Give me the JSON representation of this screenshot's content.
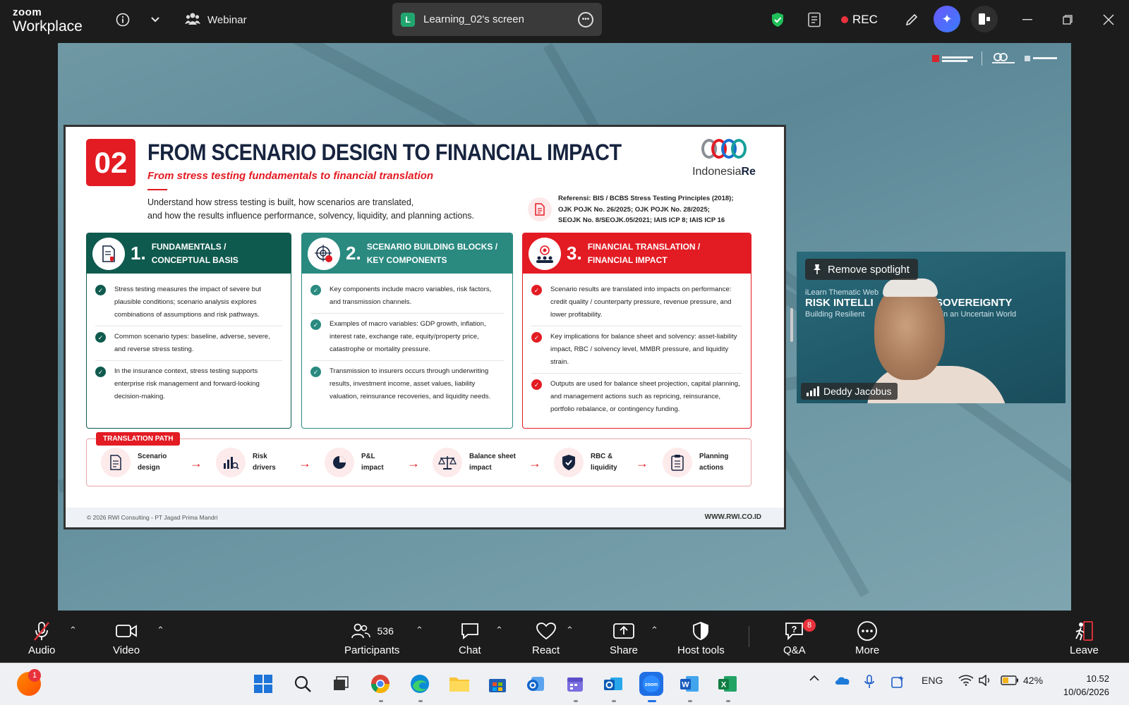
{
  "topbar": {
    "brand_small": "zoom",
    "brand_large": "Workplace",
    "webinar_label": "Webinar",
    "screen_badge": "L",
    "screen_title": "Learning_02's screen",
    "rec_label": "REC",
    "icons": [
      "info-icon",
      "chevron-down-icon",
      "participants-icon",
      "shield-icon",
      "notes-icon",
      "edit-icon",
      "ai-companion-icon",
      "apps-icon",
      "minimize-icon",
      "restore-icon",
      "close-icon"
    ]
  },
  "slide": {
    "number": "02",
    "title": "FROM SCENARIO DESIGN TO FINANCIAL IMPACT",
    "subtitle": "From stress testing fundamentals to financial translation",
    "logo_text_a": "Indonesia",
    "logo_text_b": "Re",
    "intro_line1": "Understand how stress testing is built, how scenarios are translated,",
    "intro_line2": "and how the results influence performance, solvency, liquidity, and planning actions.",
    "ref_line1": "Referensi:  BIS / BCBS Stress Testing Principles (2018);",
    "ref_line2": "OJK POJK No. 26/2025; OJK POJK No. 28/2025;",
    "ref_line3": "SEOJK No. 8/SEOJK.05/2021; IAIS ICP 8; IAIS ICP 16",
    "columns": [
      {
        "num": "1.",
        "title1": "FUNDAMENTALS /",
        "title2": "CONCEPTUAL BASIS",
        "color": "#0f5a4e",
        "items": [
          "Stress testing measures the impact of severe but plausible conditions; scenario analysis explores combinations of assumptions and risk pathways.",
          "Common scenario types: baseline, adverse, severe, and reverse stress testing.",
          "In the insurance context, stress testing supports enterprise risk management and forward-looking decision-making."
        ]
      },
      {
        "num": "2.",
        "title1": "SCENARIO BUILDING BLOCKS /",
        "title2": "KEY COMPONENTS",
        "color": "#2a8a80",
        "items": [
          "Key components include macro variables, risk factors, and transmission channels.",
          "Examples of macro variables: GDP growth, inflation, interest rate, exchange rate, equity/property price, catastrophe or mortality pressure.",
          "Transmission to insurers occurs through underwriting results, investment income, asset values, liability valuation, reinsurance recoveries, and liquidity needs."
        ]
      },
      {
        "num": "3.",
        "title1": "FINANCIAL TRANSLATION /",
        "title2": "FINANCIAL IMPACT",
        "color": "#e31b23",
        "items": [
          "Scenario results are translated into impacts on performance: credit quality / counterparty pressure, revenue pressure, and lower profitability.",
          "Key implications for balance sheet and solvency: asset-liability impact, RBC / solvency level, MMBR pressure, and liquidity strain.",
          "Outputs are used for balance sheet projection, capital planning, and management actions such as repricing, reinsurance, portfolio rebalance, or contingency funding."
        ]
      }
    ],
    "path_label": "TRANSLATION PATH",
    "path_steps": [
      {
        "l1": "Scenario",
        "l2": "design"
      },
      {
        "l1": "Risk",
        "l2": "drivers"
      },
      {
        "l1": "P&L",
        "l2": "impact"
      },
      {
        "l1": "Balance sheet",
        "l2": "impact"
      },
      {
        "l1": "RBC &",
        "l2": "liquidity"
      },
      {
        "l1": "Planning",
        "l2": "actions"
      }
    ],
    "footer_left": "© 2026 RWI Consulting - PT Jagad Prima Mandri",
    "footer_right": "WWW.RWI.CO.ID"
  },
  "speaker": {
    "spotlight_label": "Remove spotlight",
    "name": "Deddy Jacobus",
    "bg_line1": "iLearn Thematic Web",
    "bg_line2": "RISK INTELLI",
    "bg_line3": "Building Resilient",
    "bg_right1": "SOVEREIGNTY",
    "bg_right2": "s in an Uncertain World"
  },
  "toolbar": {
    "audio": "Audio",
    "video": "Video",
    "participants": "Participants",
    "participants_count": "536",
    "chat": "Chat",
    "react": "React",
    "share": "Share",
    "host_tools": "Host tools",
    "qa": "Q&A",
    "qa_badge": "8",
    "more": "More",
    "leave": "Leave"
  },
  "taskbar": {
    "notif_badge": "1",
    "lang": "ENG",
    "battery": "42%",
    "time": "10.52",
    "date": "10/06/2026"
  }
}
